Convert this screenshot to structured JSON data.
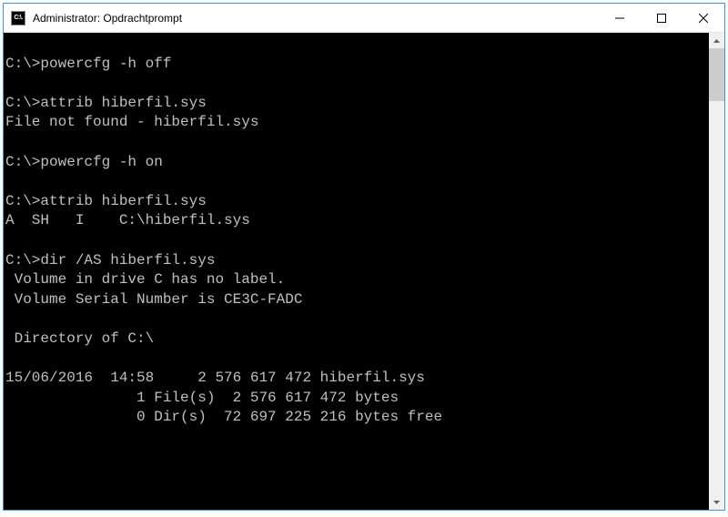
{
  "window": {
    "title": "Administrator: Opdrachtprompt",
    "icon_label": "C:\\."
  },
  "terminal": {
    "lines": [
      "",
      "C:\\>powercfg -h off",
      "",
      "C:\\>attrib hiberfil.sys",
      "File not found - hiberfil.sys",
      "",
      "C:\\>powercfg -h on",
      "",
      "C:\\>attrib hiberfil.sys",
      "A  SH   I    C:\\hiberfil.sys",
      "",
      "C:\\>dir /AS hiberfil.sys",
      " Volume in drive C has no label.",
      " Volume Serial Number is CE3C-FADC",
      "",
      " Directory of C:\\",
      "",
      "15/06/2016  14:58     2 576 617 472 hiberfil.sys",
      "               1 File(s)  2 576 617 472 bytes",
      "               0 Dir(s)  72 697 225 216 bytes free"
    ]
  }
}
